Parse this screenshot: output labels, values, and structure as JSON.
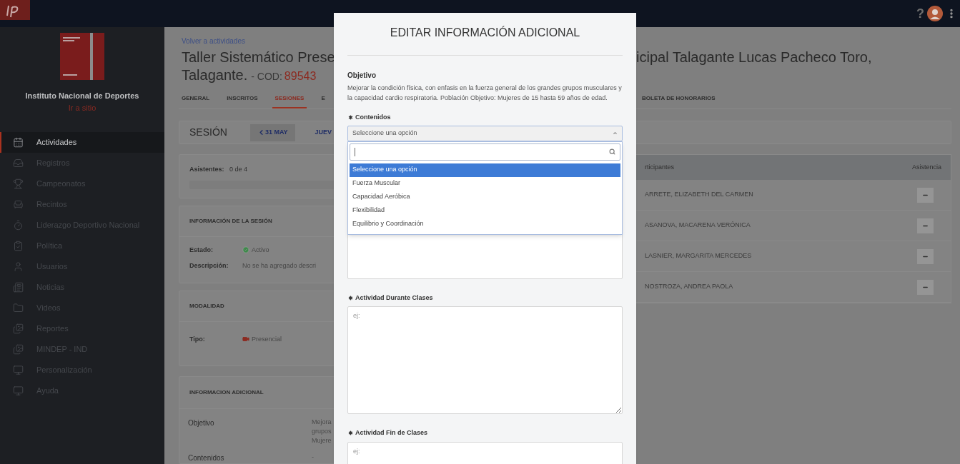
{
  "topbar": {
    "help": "?"
  },
  "sidebar": {
    "org_name": "Instituto Nacional de Deportes",
    "site_link": "Ir a sitio",
    "items": [
      {
        "label": "Actividades",
        "selected": true
      },
      {
        "label": "Registros",
        "selected": false
      },
      {
        "label": "Campeonatos",
        "selected": false
      },
      {
        "label": "Recintos",
        "selected": false
      },
      {
        "label": "Liderazgo Deportivo Nacional",
        "selected": false
      },
      {
        "label": "Política",
        "selected": false
      },
      {
        "label": "Usuarios",
        "selected": false
      },
      {
        "label": "Noticias",
        "selected": false
      },
      {
        "label": "Videos",
        "selected": false
      },
      {
        "label": "Reportes",
        "selected": false
      },
      {
        "label": "MINDEP - IND",
        "selected": false
      },
      {
        "label": "Personalización",
        "selected": false
      },
      {
        "label": "Ayuda",
        "selected": false
      }
    ]
  },
  "page": {
    "back_link": "Volver a actividades",
    "title_left": "Taller Sistemático Prese",
    "title_right": "icipal Talagante Lucas Pacheco Toro,",
    "title_line2": "Talagante.",
    "code_label": "- COD:",
    "code": "89543",
    "tabs_left": [
      {
        "label": "GENERAL",
        "selected": false
      },
      {
        "label": "INSCRITOS",
        "selected": false
      },
      {
        "label": "SESIONES",
        "selected": true
      },
      {
        "label": "E",
        "selected": false
      }
    ],
    "tabs_right": [
      {
        "label": "BOLETA DE HONORARIOS",
        "selected": false
      }
    ],
    "session": {
      "title": "SESIÓN",
      "prev": "31 MAY",
      "next": "JUEV"
    },
    "attendance": {
      "label": "Asistentes:",
      "value": "0 de 4",
      "level": 0
    },
    "session_info": {
      "title": "INFORMACIÓN DE LA SESIÓN",
      "fields": [
        {
          "label": "Estado:",
          "value": "Activo",
          "kind": "status"
        },
        {
          "label": "Descripción:",
          "value": "No se ha agregado descri",
          "kind": "text"
        }
      ]
    },
    "modality": {
      "title": "MODALIDAD",
      "fields": [
        {
          "label": "Tipo:",
          "value": "Presencial",
          "kind": "video"
        }
      ]
    },
    "additional_info": {
      "title": "INFORMACION ADICIONAL",
      "rows": [
        {
          "label": "Objetivo",
          "value_lines": [
            "Mejora",
            "grupos",
            "Mujere"
          ]
        },
        {
          "label": "Contenidos",
          "value_lines": [
            "-"
          ]
        }
      ]
    },
    "participants": {
      "columns": [
        "rticipantes",
        "Asistencia"
      ],
      "rows": [
        {
          "name": "ARRETE, ELIZABETH DEL CARMEN"
        },
        {
          "name": "ASANOVA, MACARENA VERÓNICA"
        },
        {
          "name": "LASNIER, MARGARITA MERCEDES"
        },
        {
          "name": "NOSTROZA, ANDREA PAOLA"
        }
      ]
    }
  },
  "modal": {
    "title": "EDITAR INFORMACIÓN ADICIONAL",
    "objective_label": "Objetivo",
    "objective_text": "Mejorar la condición física, con enfasis en la fuerza general de los grandes grupos musculares y la capacidad cardio respiratoria. Población Objetivo: Mujeres de 15 hasta 59 años de edad.",
    "fields": [
      {
        "label": "Contenidos",
        "required": true,
        "kind": "select",
        "value": "Seleccione una opción",
        "expanded": true,
        "options": [
          {
            "label": "Seleccione una opción",
            "selected": true
          },
          {
            "label": "Fuerza Muscular",
            "selected": false
          },
          {
            "label": "Capacidad Aeróbica",
            "selected": false
          },
          {
            "label": "Flexibilidad",
            "selected": false
          },
          {
            "label": "Equilibrio y Coordinación",
            "selected": false
          }
        ]
      },
      {
        "label": "Actividad Durante Clases",
        "required": true,
        "kind": "textarea",
        "placeholder": "ej:"
      },
      {
        "label": "Actividad Fin de Clases",
        "required": true,
        "kind": "textarea",
        "placeholder": "ej:"
      }
    ]
  }
}
